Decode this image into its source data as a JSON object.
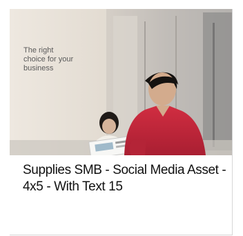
{
  "card": {
    "image": {
      "overlay_text": "The right\nchoice for your\nbusiness"
    },
    "title": "Supplies SMB - Social Media Asset - 4x5 - With Text 15"
  },
  "colors": {
    "shirt_red": "#c8263a",
    "wall_beige": "#e4dcd2",
    "title_text": "#111111"
  }
}
